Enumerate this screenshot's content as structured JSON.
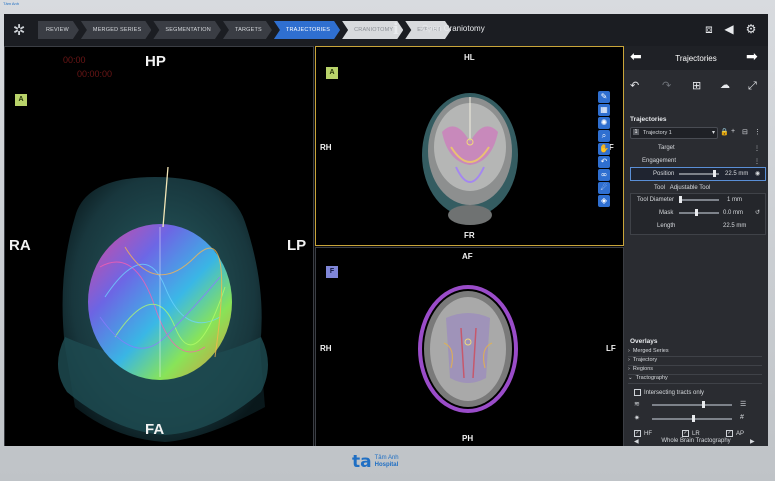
{
  "hospital": {
    "brand_mark": "ta",
    "name_line1": "Tâm Anh",
    "name_line2": "Hospital"
  },
  "workflow_steps": [
    {
      "label": "REVIEW",
      "state": "normal"
    },
    {
      "label": "MERGED SERIES",
      "state": "normal"
    },
    {
      "label": "SEGMENTATION",
      "state": "normal"
    },
    {
      "label": "TARGETS",
      "state": "normal"
    },
    {
      "label": "TRAJECTORIES",
      "state": "active"
    },
    {
      "label": "CRANIOTOMY",
      "state": "disabled"
    },
    {
      "label": "EXPORT",
      "state": "disabled"
    }
  ],
  "header": {
    "procedure_title": "Open Craniotomy",
    "icons": [
      "camera-icon",
      "speaker-icon",
      "settings-icon"
    ]
  },
  "viewports": {
    "view3d": {
      "badge": "A",
      "top": "HP",
      "bottom": "FA",
      "left": "RA",
      "right": "LP",
      "overlay_red_1": "00:00",
      "overlay_red_2": "00:00:00"
    },
    "coronal": {
      "badge": "A",
      "top": "HL",
      "bottom": "FR",
      "left": "RH",
      "right": "LF"
    },
    "axial": {
      "badge": "F",
      "top": "AF",
      "bottom": "PH",
      "left": "RH",
      "right": "LF"
    }
  },
  "panel": {
    "title": "Trajectories",
    "section_label": "Trajectories",
    "trajectory_select": "Trajectory 1",
    "target_label": "Target",
    "engagement_label": "Engagement",
    "position_label": "Position",
    "position_value": "22.5 mm",
    "position_fraction": 0.85,
    "tool_label": "Tool",
    "tool_value": "Adjustable Tool",
    "tool_diameter_label": "Tool Diameter",
    "tool_diameter_value": "1 mm",
    "mask_label": "Mask",
    "mask_value": "0.0 mm",
    "length_label": "Length",
    "length_value": "22.5 mm",
    "overlays_title": "Overlays",
    "overlay_items": [
      "Merged Series",
      "Trajectory",
      "Regions",
      "Tractography"
    ],
    "intersecting_label": "Intersecting tracts only",
    "slider1_fraction": 0.62,
    "slider2_fraction": 0.5,
    "checkbox_hf": "HF",
    "checkbox_lr": "LR",
    "checkbox_ap": "AP",
    "bottom_selector": "Whole Brain Tractography"
  }
}
